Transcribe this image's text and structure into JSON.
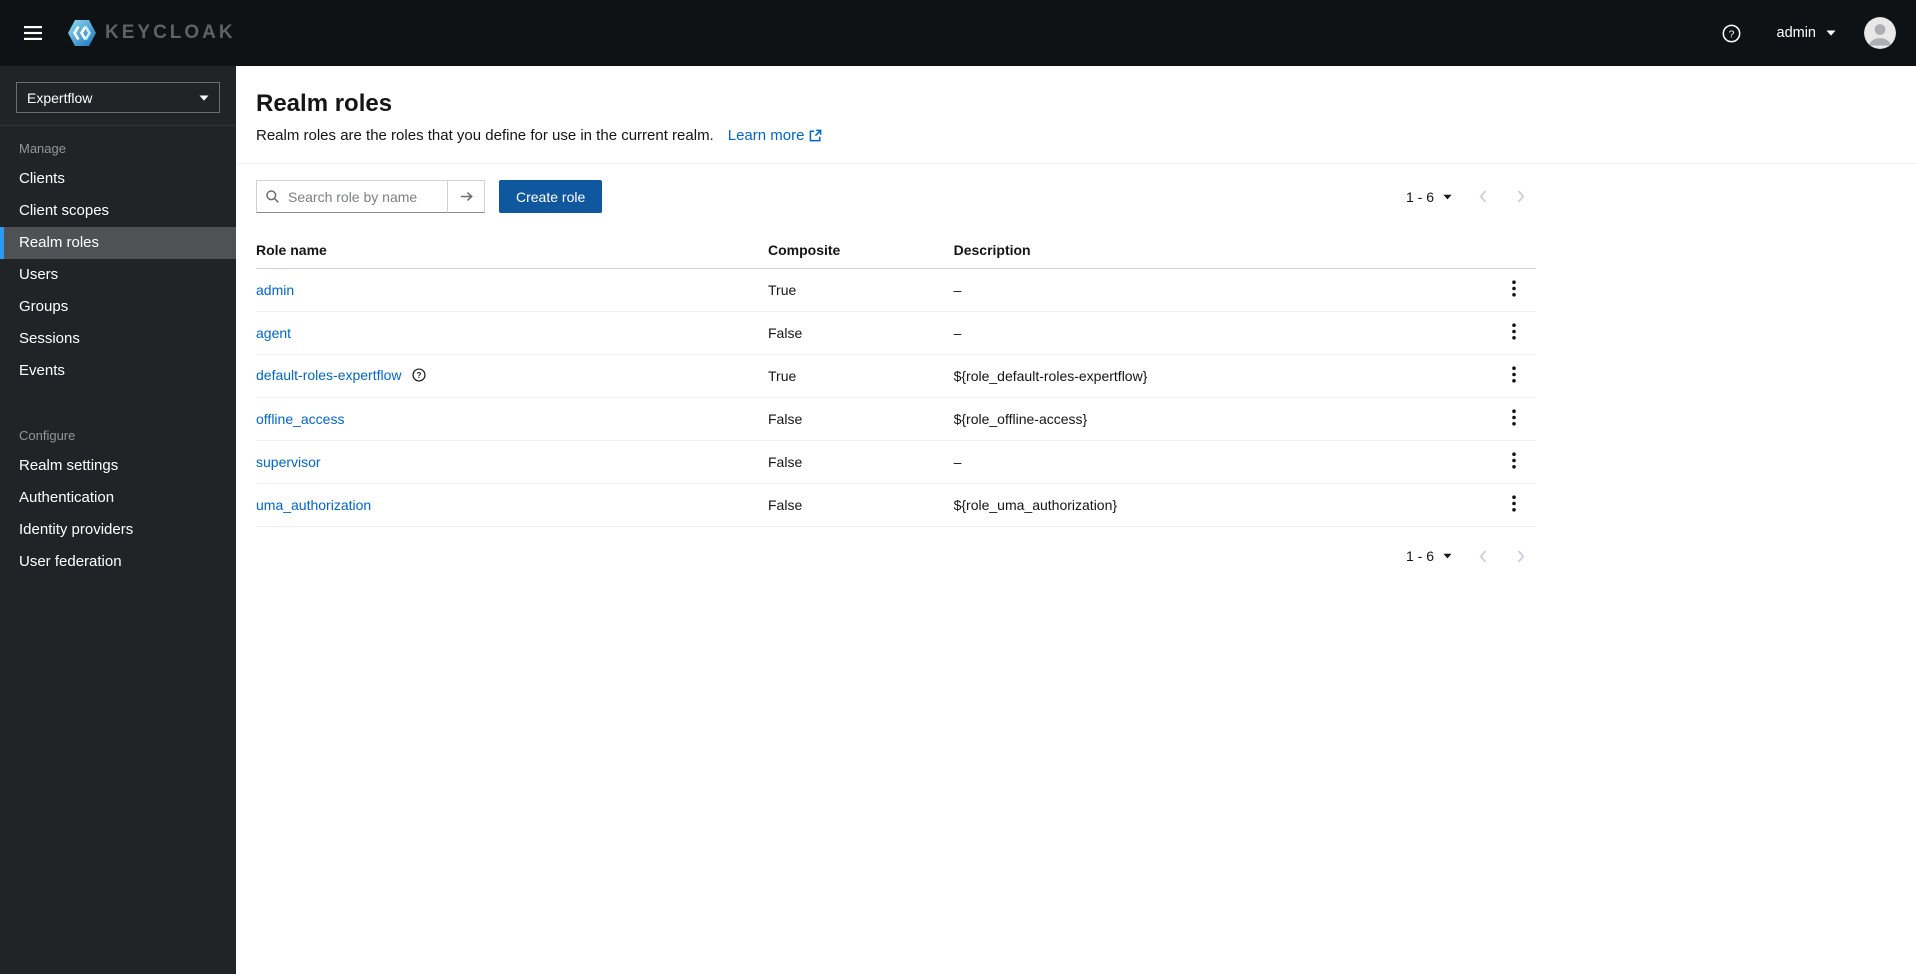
{
  "colors": {
    "topbar_bg": "#0f1214",
    "sidebar_bg": "#212427",
    "nav_current_bg": "#4f5255",
    "nav_current_accent": "#2b9af3",
    "link_blue": "#0066cc",
    "primary_button_bg": "#0f579e",
    "text": "#151515"
  },
  "icons": {
    "hamburger": "three-bars",
    "keycloak-logo": "blue-hex-shield",
    "help": "question-circle",
    "caret-down": "filled-triangle-down",
    "avatar": "user-silhouette",
    "search": "magnifier",
    "search-submit": "arrow-right",
    "external-link": "box-arrow",
    "chevron-left": "‹",
    "chevron-right": "›",
    "kebab": "vertical-dots",
    "row-help": "question-circle"
  },
  "topbar": {
    "brand_text": "KEYCLOAK",
    "username": "admin"
  },
  "sidebar": {
    "realm_selector": {
      "value": "Expertflow"
    },
    "sections": [
      {
        "label": "Manage",
        "items": [
          {
            "label": "Clients",
            "active": false
          },
          {
            "label": "Client scopes",
            "active": false
          },
          {
            "label": "Realm roles",
            "active": true
          },
          {
            "label": "Users",
            "active": false
          },
          {
            "label": "Groups",
            "active": false
          },
          {
            "label": "Sessions",
            "active": false
          },
          {
            "label": "Events",
            "active": false
          }
        ]
      },
      {
        "label": "Configure",
        "items": [
          {
            "label": "Realm settings",
            "active": false
          },
          {
            "label": "Authentication",
            "active": false
          },
          {
            "label": "Identity providers",
            "active": false
          },
          {
            "label": "User federation",
            "active": false
          }
        ]
      }
    ]
  },
  "page": {
    "title": "Realm roles",
    "description": "Realm roles are the roles that you define for use in the current realm.",
    "learn_more_label": "Learn more",
    "toolbar": {
      "search_placeholder": "Search role by name",
      "create_button_label": "Create role"
    },
    "pagination": {
      "range_label": "1 - 6"
    },
    "table": {
      "headers": {
        "role_name": "Role name",
        "composite": "Composite",
        "description": "Description"
      },
      "rows": [
        {
          "name": "admin",
          "composite": "True",
          "description": "–",
          "has_help": false
        },
        {
          "name": "agent",
          "composite": "False",
          "description": "–",
          "has_help": false
        },
        {
          "name": "default-roles-expertflow",
          "composite": "True",
          "description": "${role_default-roles-expertflow}",
          "has_help": true
        },
        {
          "name": "offline_access",
          "composite": "False",
          "description": "${role_offline-access}",
          "has_help": false
        },
        {
          "name": "supervisor",
          "composite": "False",
          "description": "–",
          "has_help": false
        },
        {
          "name": "uma_authorization",
          "composite": "False",
          "description": "${role_uma_authorization}",
          "has_help": false
        }
      ]
    }
  }
}
